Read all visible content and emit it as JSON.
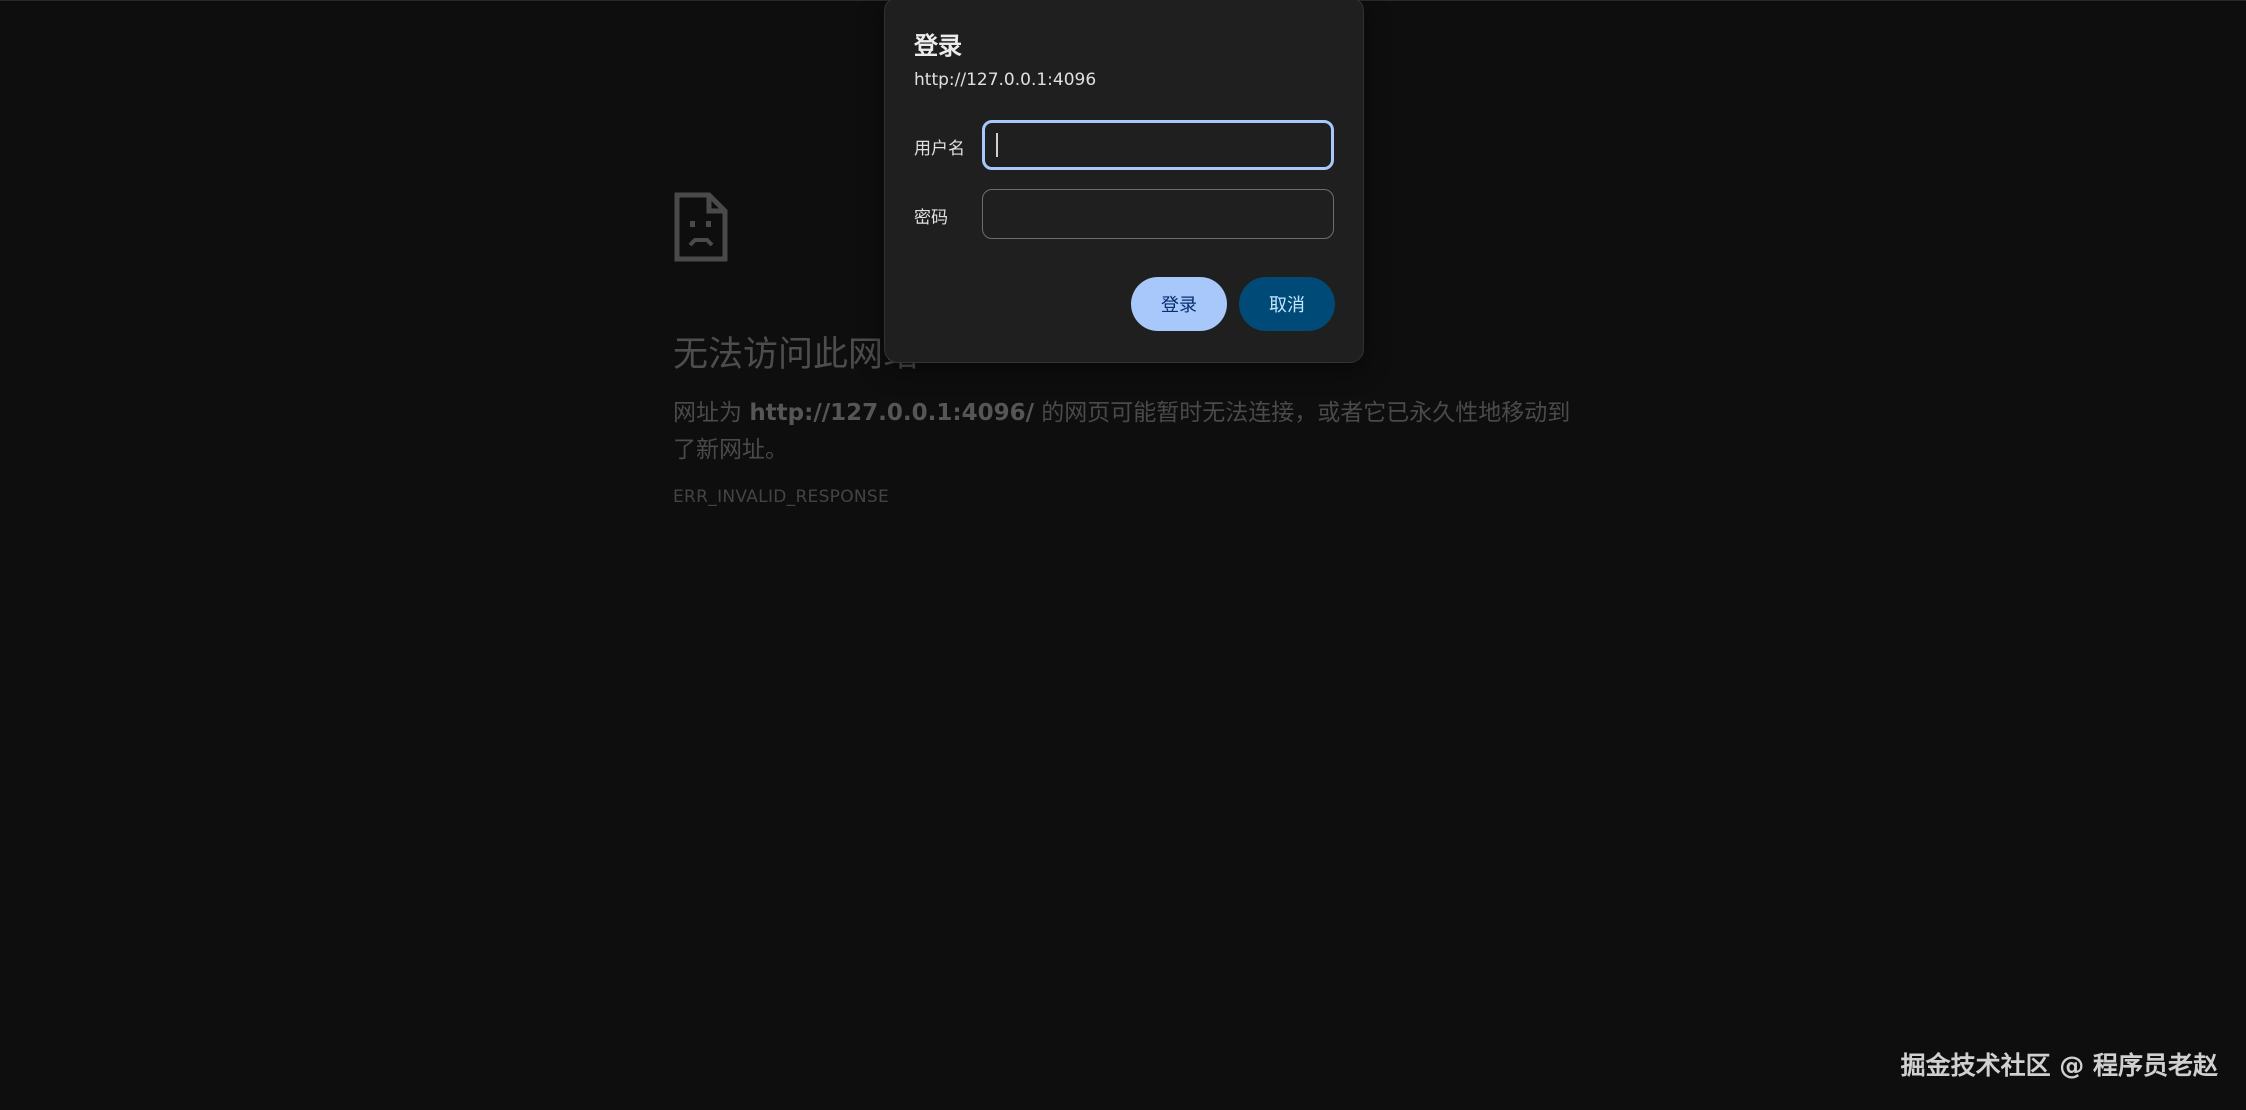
{
  "error_page": {
    "icon": "sad-page-icon",
    "title": "无法访问此网站",
    "desc_prefix": "网址为 ",
    "desc_url": "http://127.0.0.1:4096/",
    "desc_suffix": " 的网页可能暂时无法连接，或者它已永久性地移动到了新网址。",
    "error_code": "ERR_INVALID_RESPONSE"
  },
  "dialog": {
    "title": "登录",
    "origin": "http://127.0.0.1:4096",
    "username_label": "用户名",
    "username_value": "",
    "password_label": "密码",
    "password_value": "",
    "login_button": "登录",
    "cancel_button": "取消"
  },
  "watermark": "掘金技术社区 @ 程序员老赵",
  "colors": {
    "background": "#0e0e0e",
    "dialog_bg": "#1f1f1f",
    "focus_border": "#a8c7fa",
    "login_button_bg": "#a8c7fa",
    "cancel_button_bg": "#004a77"
  }
}
